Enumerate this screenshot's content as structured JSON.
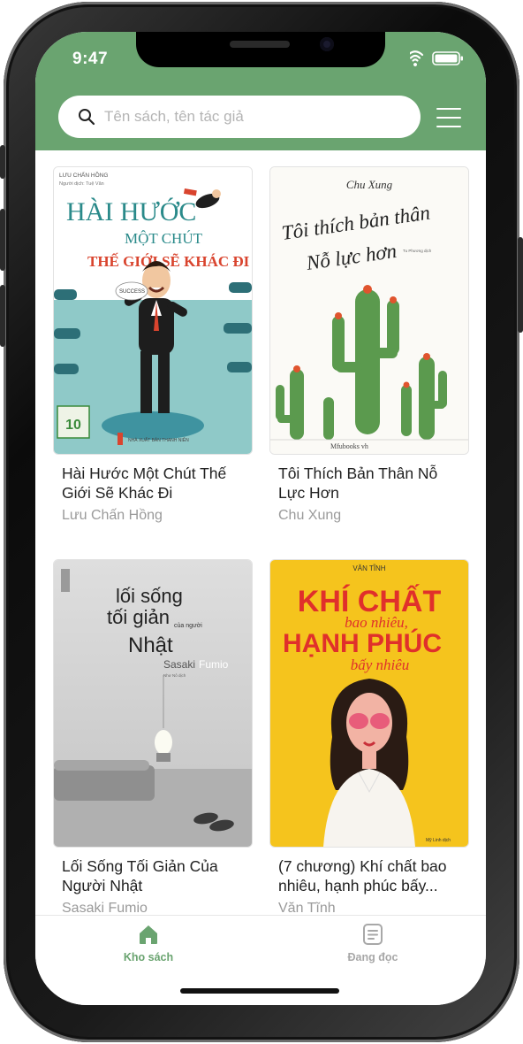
{
  "status_bar": {
    "time": "9:47"
  },
  "search": {
    "placeholder": "Tên sách, tên tác giả",
    "icon": "search-icon"
  },
  "menu": {
    "icon": "hamburger-menu-icon"
  },
  "books": [
    {
      "title": "Hài Hước Một Chút Thế Giới Sẽ Khác Đi",
      "author": "Lưu Chấn Hồng",
      "cover": {
        "top_text": "LƯU CHẤN HỒNG",
        "top_text_2": "Người dịch: Tuệ Văn",
        "line1": "HÀI HƯỚC",
        "line2": "MỘT CHÚT",
        "line3": "THẾ GIỚI SẼ KHÁC ĐI",
        "badge": "SUCCESS",
        "publisher": "NHÀ XUẤT BẢN THANH NIÊN",
        "bg": "#8fc9c8",
        "title_color": "#2a8a8a",
        "accent_color": "#d9442e"
      }
    },
    {
      "title": "Tôi Thích Bản Thân Nỗ Lực Hơn",
      "author": "Chu Xung",
      "cover": {
        "top_text": "Chu Xung",
        "line1": "Tôi thích bản thân",
        "line2": "Nỗ lực hơn",
        "translator": "Tu Phương dịch",
        "publisher": "Mfubooks vh",
        "bg": "#fbfaf6",
        "plant_color": "#5b9a4e",
        "flower_color": "#e0542e"
      }
    },
    {
      "title": "Lối Sống Tối Giản Của Người Nhật",
      "author": "Sasaki Fumio",
      "cover": {
        "line1": "lối sống",
        "line2": "tối giản",
        "line3": "của người",
        "line4": "Nhật",
        "author_a": "Sasaki",
        "author_b": "Fumio",
        "translator": "Như Nô dịch",
        "bg": "#d9d9d9"
      }
    },
    {
      "title": "(7 chương) Khí chất bao nhiêu, hạnh phúc bấy...",
      "author": "Văn Tĩnh",
      "cover": {
        "top_text": "VĂN TĨNH",
        "line1": "KHÍ CHẤT",
        "line2": "bao nhiêu,",
        "line3": "HẠNH PHÚC",
        "line4": "bấy nhiêu",
        "translator": "Mỹ Linh dịch",
        "bg": "#f5c41d",
        "title_color": "#e0302b"
      }
    }
  ],
  "tabbar": {
    "tabs": [
      {
        "label": "Kho sách",
        "icon": "home-icon",
        "active": true
      },
      {
        "label": "Đang đọc",
        "icon": "document-icon",
        "active": false
      }
    ],
    "active_color": "#6aa470",
    "inactive_color": "#a8a8a8"
  },
  "colors": {
    "header": "#6aa470"
  }
}
